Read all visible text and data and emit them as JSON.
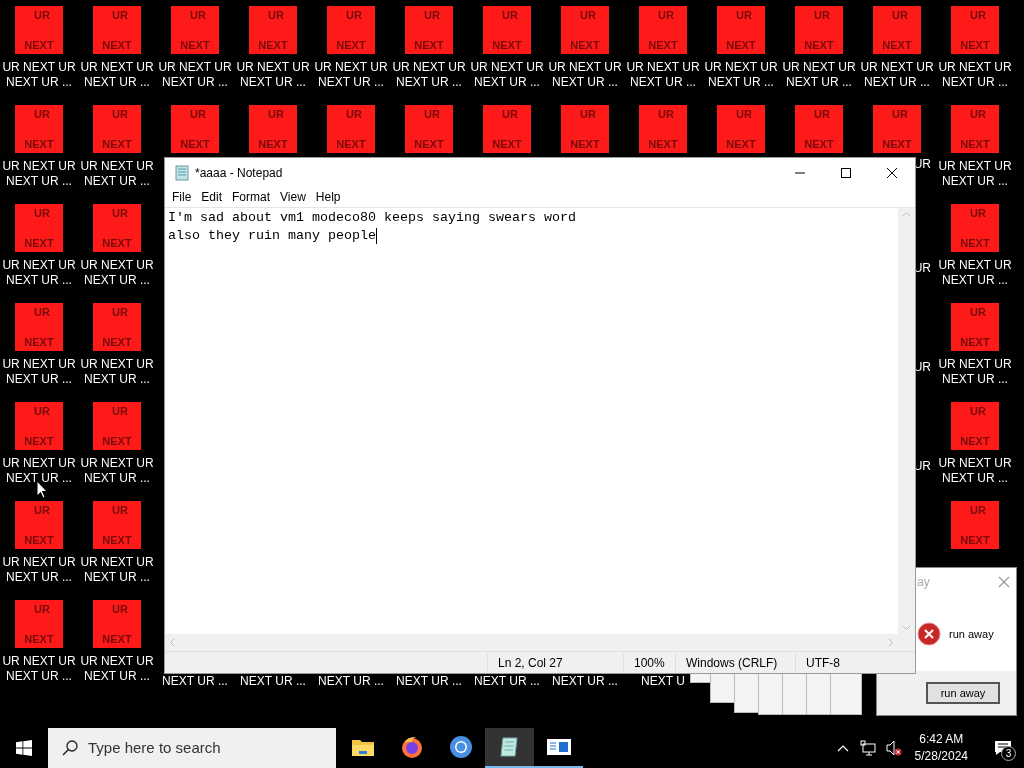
{
  "desktop_rows": [
    {
      "left": [
        {
          "top": "UR",
          "bottom": "NEXT",
          "lines": [
            "UR NEXT UR",
            "NEXT UR ..."
          ]
        },
        {
          "top": "UR",
          "bottom": "NEXT",
          "lines": [
            "UR NEXT UR",
            "NEXT UR ..."
          ]
        }
      ],
      "middle": [
        {
          "top": "UR",
          "bottom": "NEXT",
          "lines": [
            "UR NEXT UR",
            "NEXT UR ..."
          ]
        },
        {
          "top": "UR",
          "bottom": "NEXT",
          "lines": [
            "UR NEXT UR",
            "NEXT UR ..."
          ]
        },
        {
          "top": "UR",
          "bottom": "NEXT",
          "lines": [
            "UR NEXT UR",
            "NEXT UR ..."
          ]
        },
        {
          "top": "UR",
          "bottom": "NEXT",
          "lines": [
            "UR NEXT UR",
            "NEXT UR ..."
          ]
        },
        {
          "top": "UR",
          "bottom": "NEXT",
          "lines": [
            "UR NEXT UR",
            "NEXT UR ..."
          ]
        },
        {
          "top": "UR",
          "bottom": "NEXT",
          "lines": [
            "UR NEXT UR",
            "NEXT UR ..."
          ]
        },
        {
          "top": "UR",
          "bottom": "NEXT",
          "lines": [
            "UR NEXT UR",
            "NEXT UR ..."
          ]
        },
        {
          "top": "UR",
          "bottom": "NEXT",
          "lines": [
            "UR NEXT UR",
            "NEXT UR ..."
          ]
        },
        {
          "top": "UR",
          "bottom": "NEXT",
          "lines": [
            "UR NEXT UR",
            "NEXT UR ..."
          ]
        }
      ],
      "right": [
        {
          "top": "UR",
          "bottom": "NEXT",
          "lines": [
            "UR NEXT UR",
            "NEXT UR ..."
          ]
        },
        {
          "top": "UR",
          "bottom": "NEXT",
          "lines": [
            "UR NEXT UR",
            "NEXT UR ..."
          ]
        }
      ]
    },
    {
      "left": [
        {
          "top": "UR",
          "bottom": "NEXT",
          "lines": [
            "UR NEXT UR",
            "NEXT UR ..."
          ]
        },
        {
          "top": "UR",
          "bottom": "NEXT",
          "lines": [
            "UR NEXT UR",
            "NEXT UR ..."
          ]
        }
      ],
      "middle": [
        {
          "top": "UR",
          "bottom": "NEXT"
        },
        {
          "top": "UR",
          "bottom": "NEXT"
        },
        {
          "top": "UR",
          "bottom": "NEXT"
        },
        {
          "top": "UR",
          "bottom": "NEXT"
        },
        {
          "top": "UR",
          "bottom": "NEXT"
        },
        {
          "top": "UR",
          "bottom": "NEXT"
        },
        {
          "top": "UR",
          "bottom": "NEXT"
        },
        {
          "top": "UR",
          "bottom": "NEXT"
        },
        {
          "top": "UR",
          "bottom": "NEXT"
        }
      ],
      "right": [
        {
          "top": "UR",
          "bottom": "NEXT",
          "lines": [
            "UR"
          ]
        },
        {
          "top": "UR",
          "bottom": "NEXT",
          "lines": [
            "UR NEXT UR",
            "NEXT UR ..."
          ]
        }
      ]
    },
    {
      "left": [
        {
          "top": "UR",
          "bottom": "NEXT",
          "lines": [
            "UR NEXT UR",
            "NEXT UR ..."
          ]
        },
        {
          "top": "UR",
          "bottom": "NEXT",
          "lines": [
            "UR NEXT UR",
            "NEXT UR ..."
          ]
        }
      ],
      "middle": [],
      "right": [
        {
          "lines": [
            "UR"
          ]
        },
        {
          "top": "UR",
          "bottom": "NEXT",
          "lines": [
            "UR NEXT UR",
            "NEXT UR ..."
          ]
        }
      ]
    },
    {
      "left": [
        {
          "top": "UR",
          "bottom": "NEXT",
          "lines": [
            "UR NEXT UR",
            "NEXT UR ..."
          ]
        },
        {
          "top": "UR",
          "bottom": "NEXT",
          "lines": [
            "UR NEXT UR",
            "NEXT UR ..."
          ]
        }
      ],
      "middle": [],
      "right": [
        {
          "lines": [
            "UR"
          ]
        },
        {
          "top": "UR",
          "bottom": "NEXT",
          "lines": [
            "UR NEXT UR",
            "NEXT UR ..."
          ]
        }
      ]
    },
    {
      "left": [
        {
          "top": "UR",
          "bottom": "NEXT",
          "lines": [
            "UR NEXT UR",
            "NEXT UR ..."
          ]
        },
        {
          "top": "UR",
          "bottom": "NEXT",
          "lines": [
            "UR NEXT UR",
            "NEXT UR ..."
          ]
        }
      ],
      "middle": [],
      "right": [
        {
          "lines": [
            "UR"
          ]
        },
        {
          "top": "UR",
          "bottom": "NEXT",
          "lines": [
            "UR NEXT UR",
            "NEXT UR ..."
          ]
        }
      ]
    },
    {
      "left": [
        {
          "top": "UR",
          "bottom": "NEXT",
          "lines": [
            "UR NEXT UR",
            "NEXT UR ..."
          ]
        },
        {
          "top": "UR",
          "bottom": "NEXT",
          "lines": [
            "UR NEXT UR",
            "NEXT UR ..."
          ]
        }
      ],
      "middle": [],
      "right": [
        {
          "top": "UR",
          "bottom": "NEXT"
        }
      ]
    },
    {
      "left": [
        {
          "top": "UR",
          "bottom": "NEXT",
          "lines": [
            "UR NEXT UR",
            "NEXT UR ..."
          ]
        },
        {
          "top": "UR",
          "bottom": "NEXT",
          "lines": [
            "UR NEXT UR",
            "NEXT UR ..."
          ]
        }
      ],
      "middle": [
        {
          "lines": [
            "NEXT UR ..."
          ]
        },
        {
          "lines": [
            "NEXT UR ..."
          ]
        },
        {
          "lines": [
            "NEXT UR ..."
          ]
        },
        {
          "lines": [
            "NEXT UR ..."
          ]
        },
        {
          "lines": [
            "NEXT UR ..."
          ]
        },
        {
          "lines": [
            "NEXT UR ..."
          ]
        },
        {
          "lines": [
            "NEXT U"
          ]
        }
      ],
      "right": []
    }
  ],
  "notepad": {
    "title": "*aaaa - Notepad",
    "menu": [
      "File",
      "Edit",
      "Format",
      "View",
      "Help"
    ],
    "lines": [
      "I'm sad about vm1 modeco80 keeps saying swears word",
      "also they ruin many people"
    ],
    "caret": true,
    "status": [
      "Ln 2, Col 27",
      "100%",
      "Windows (CRLF)",
      "UTF-8"
    ]
  },
  "dialog": {
    "title": "ay",
    "message": "run away",
    "button": "run away"
  },
  "taskbar": {
    "search_placeholder": "Type here to search",
    "apps": [
      {
        "kind": "folder",
        "selected": false,
        "running": false
      },
      {
        "kind": "firefox",
        "selected": false,
        "running": false
      },
      {
        "kind": "chromium",
        "selected": false,
        "running": false
      },
      {
        "kind": "notepad",
        "selected": true,
        "running": true
      },
      {
        "kind": "window",
        "selected": false,
        "running": true
      }
    ],
    "time": "6:42 AM",
    "date": "5/28/2024",
    "notification_count": "3"
  }
}
